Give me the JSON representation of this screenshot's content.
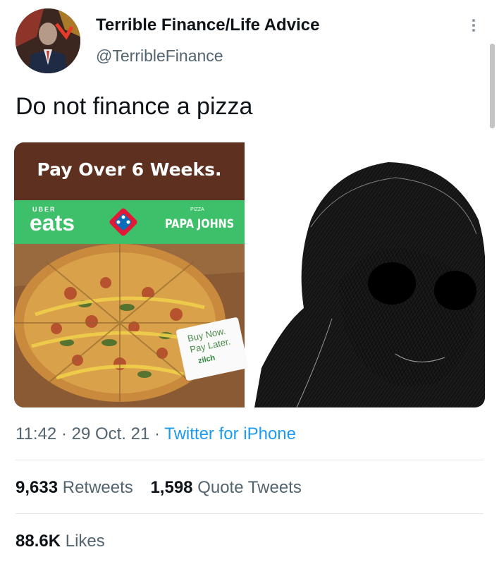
{
  "author": {
    "name": "Terrible Finance/Life Advice",
    "handle": "@TerribleFinance"
  },
  "tweet": {
    "text": "Do not finance a pizza"
  },
  "media": {
    "ad": {
      "headline": "Pay Over 6 Weeks.",
      "uber_small": "UBER",
      "uber_eats": "eats",
      "papa_small": "PIZZA",
      "papa_johns": "PAPA JOHNS",
      "card_line1": "Buy Now.",
      "card_line2": "Pay Later.",
      "card_brand": "zilch"
    }
  },
  "meta": {
    "time": "11:42",
    "sep1": " · ",
    "date": "29 Oct. 21",
    "sep2": " · ",
    "source": "Twitter for iPhone"
  },
  "stats": {
    "retweets_count": "9,633",
    "retweets_label": "Retweets",
    "quotes_count": "1,598",
    "quotes_label": "Quote Tweets",
    "likes_count": "88.6K",
    "likes_label": "Likes"
  },
  "colors": {
    "link": "#1d9bf0",
    "muted": "#536471",
    "ad_green": "#3ec06a",
    "ad_brown": "#5d3020"
  }
}
